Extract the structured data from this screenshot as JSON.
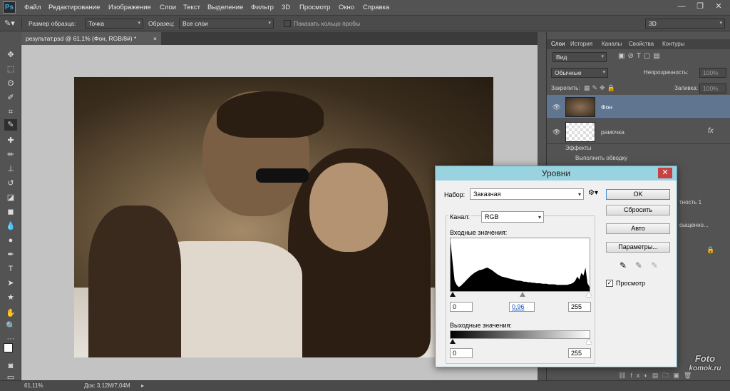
{
  "menu": {
    "logo": "Ps",
    "items": [
      "Файл",
      "Редактирование",
      "Изображение",
      "Слои",
      "Текст",
      "Выделение",
      "Фильтр",
      "3D",
      "Просмотр",
      "Окно",
      "Справка"
    ]
  },
  "window": {
    "minimize": "—",
    "restore": "❐",
    "close": "✕"
  },
  "options": {
    "sample_size_label": "Размер образца:",
    "sample_size_value": "Точка",
    "sample_label": "Образец:",
    "sample_value": "Все слои",
    "ring_label": "Показать кольцо пробы",
    "workspace": "3D"
  },
  "document": {
    "tab_title": "результат.psd @ 61,1% (Фон, RGB/8#) *",
    "tab_close": "×"
  },
  "status": {
    "zoom": "61,11%",
    "doc": "Док: 3,12M/7,04M"
  },
  "layers_panel": {
    "tabs": [
      "Слои",
      "История",
      "Каналы",
      "Свойства",
      "Контуры"
    ],
    "filter": "Вид",
    "blend_mode": "Обычные",
    "opacity_label": "Непрозрачность:",
    "opacity": "100%",
    "lock_label": "Закрепить:",
    "fill_label": "Заливка:",
    "fill": "100%",
    "layers": [
      {
        "name": "Фон"
      },
      {
        "name": "рамочка",
        "fx": "fx"
      }
    ],
    "effects_label": "Эффекты",
    "stroke_label": "Выполнить обводку",
    "partial": [
      "тность 1",
      "сыщенно..."
    ]
  },
  "levels": {
    "title": "Уровни",
    "close": "✕",
    "preset_label": "Набор:",
    "preset": "Заказная",
    "channel_label": "Канал:",
    "channel": "RGB",
    "input_label": "Входные значения:",
    "in_black": "0",
    "in_gamma": "0,96",
    "in_white": "255",
    "output_label": "Выходные значения:",
    "out_black": "0",
    "out_white": "255",
    "buttons": {
      "ok": "OK",
      "reset": "Сбросить",
      "auto": "Авто",
      "options": "Параметры..."
    },
    "preview_label": "Просмотр",
    "preview_checked": true,
    "histogram": [
      0.95,
      0.55,
      0.2,
      0.12,
      0.08,
      0.1,
      0.14,
      0.18,
      0.22,
      0.26,
      0.3,
      0.33,
      0.36,
      0.38,
      0.4,
      0.41,
      0.42,
      0.44,
      0.45,
      0.43,
      0.41,
      0.38,
      0.35,
      0.32,
      0.3,
      0.28,
      0.27,
      0.26,
      0.25,
      0.24,
      0.23,
      0.22,
      0.21,
      0.2,
      0.2,
      0.19,
      0.18,
      0.18,
      0.17,
      0.17,
      0.16,
      0.16,
      0.15,
      0.15,
      0.15,
      0.14,
      0.14,
      0.14,
      0.13,
      0.13,
      0.13,
      0.13,
      0.12,
      0.12,
      0.12,
      0.12,
      0.12,
      0.12,
      0.13,
      0.14,
      0.16,
      0.2,
      0.28,
      0.22,
      0.35,
      0.3,
      0.45,
      0.15,
      0.08
    ]
  },
  "watermark": {
    "line1": "Foto",
    "line2": "komok.ru"
  }
}
